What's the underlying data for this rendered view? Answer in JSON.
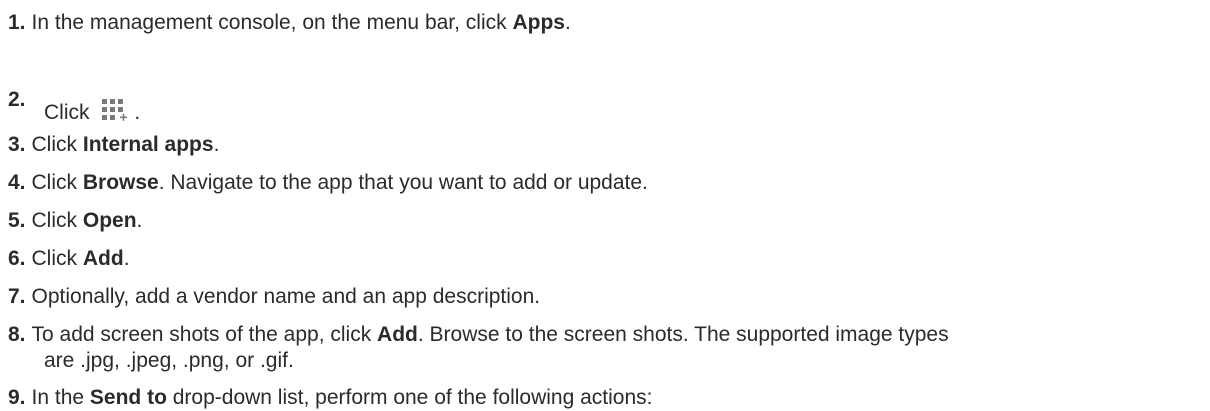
{
  "steps": {
    "s1": {
      "num": "1.",
      "pre": "In the management console, on the menu bar, click ",
      "bold": "Apps",
      "post": "."
    },
    "s2": {
      "num": "2.",
      "pre": "Click ",
      "icon": "add-app-grid-icon",
      "post": "."
    },
    "s3": {
      "num": "3.",
      "pre": "Click ",
      "bold": "Internal apps",
      "post": "."
    },
    "s4": {
      "num": "4.",
      "pre": "Click ",
      "bold": "Browse",
      "post": ". Navigate to the app that you want to add or update."
    },
    "s5": {
      "num": "5.",
      "pre": "Click ",
      "bold": "Open",
      "post": "."
    },
    "s6": {
      "num": "6.",
      "pre": "Click ",
      "bold": "Add",
      "post": "."
    },
    "s7": {
      "num": "7.",
      "text": "Optionally, add a vendor name and an app description."
    },
    "s8": {
      "num": "8.",
      "pre": "To add screen shots of the app, click ",
      "bold": "Add",
      "post": ". Browse to the screen shots. The supported image types",
      "line2": "are .jpg, .jpeg, .png, or .gif."
    },
    "s9": {
      "num": "9.",
      "pre": "In the ",
      "bold": "Send to",
      "post": " drop-down list, perform one of the following actions:"
    }
  },
  "colors": {
    "text": "#2b2b2b",
    "icon": "#7a7a7a"
  }
}
